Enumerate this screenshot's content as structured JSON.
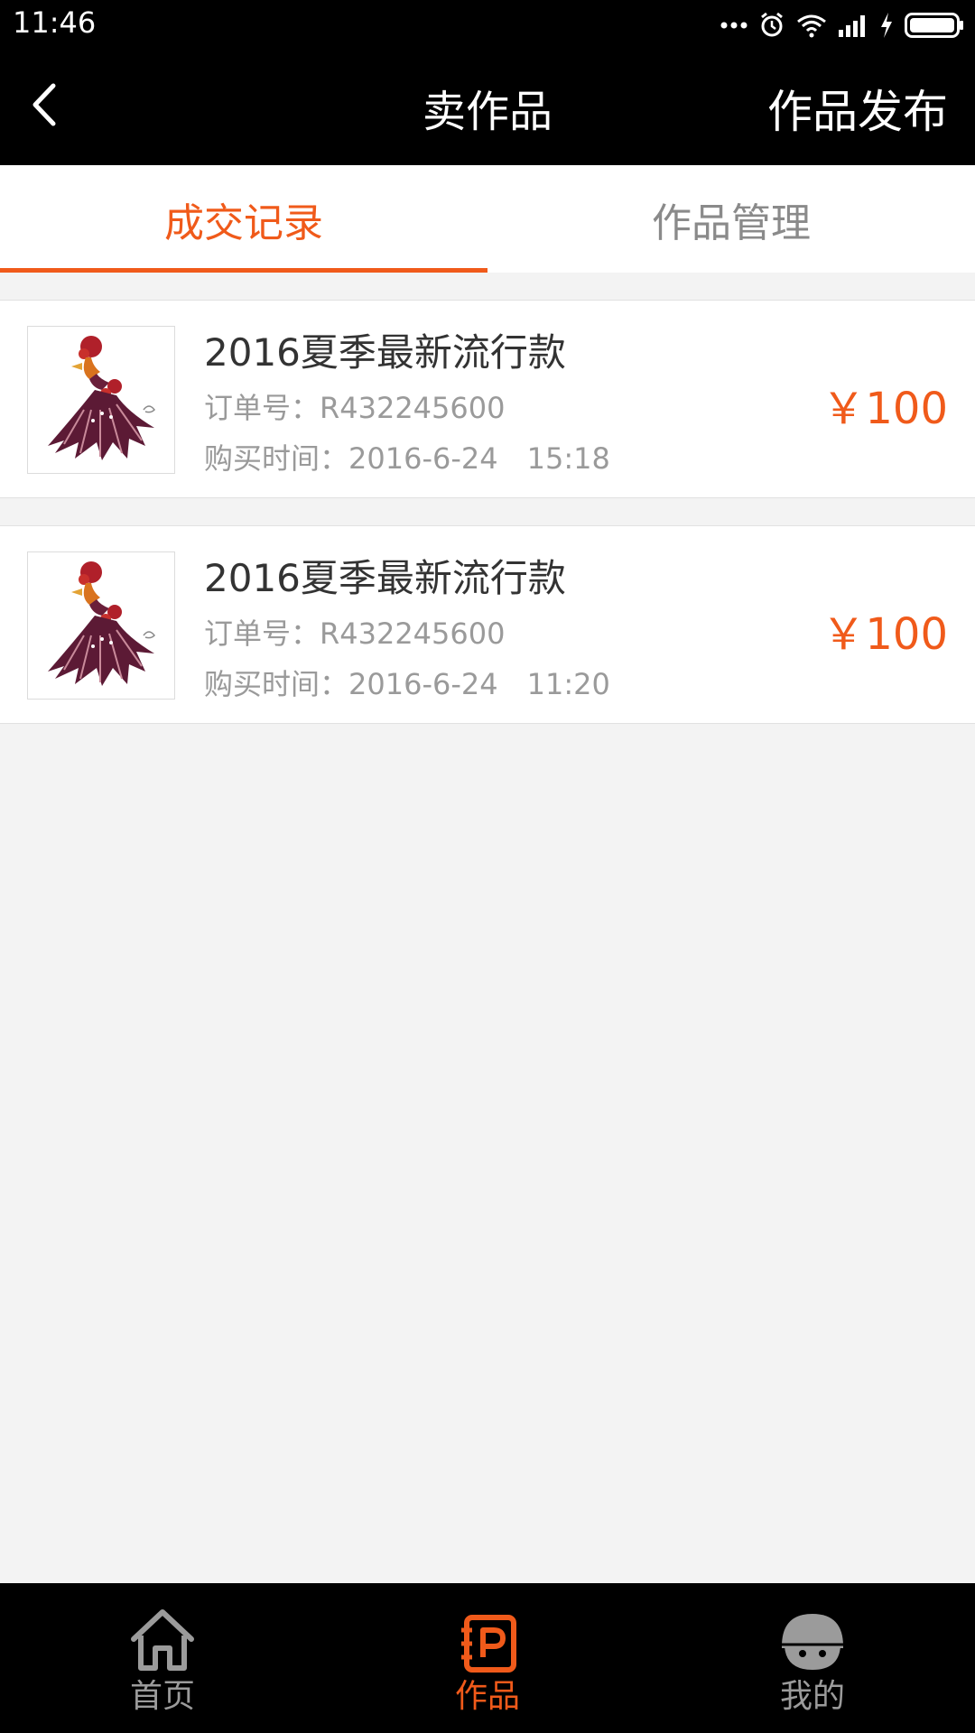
{
  "status_bar": {
    "time": "11:46"
  },
  "header": {
    "title": "卖作品",
    "publish_label": "作品发布"
  },
  "tabs": [
    {
      "label": "成交记录",
      "active": true
    },
    {
      "label": "作品管理",
      "active": false
    }
  ],
  "orders": [
    {
      "title": "2016夏季最新流行款",
      "order_no": "订单号：R432245600",
      "time": "购买时间：2016-6-24　15:18",
      "price": "￥100"
    },
    {
      "title": "2016夏季最新流行款",
      "order_no": "订单号：R432245600",
      "time": "购买时间：2016-6-24　11:20",
      "price": "￥100"
    }
  ],
  "bottom_nav": [
    {
      "label": "首页",
      "icon": "home-icon",
      "active": false
    },
    {
      "label": "作品",
      "icon": "works-icon",
      "active": true
    },
    {
      "label": "我的",
      "icon": "profile-icon",
      "active": false
    }
  ],
  "colors": {
    "accent": "#f05a1a",
    "header_bg": "#000000",
    "page_bg": "#f3f3f3"
  }
}
